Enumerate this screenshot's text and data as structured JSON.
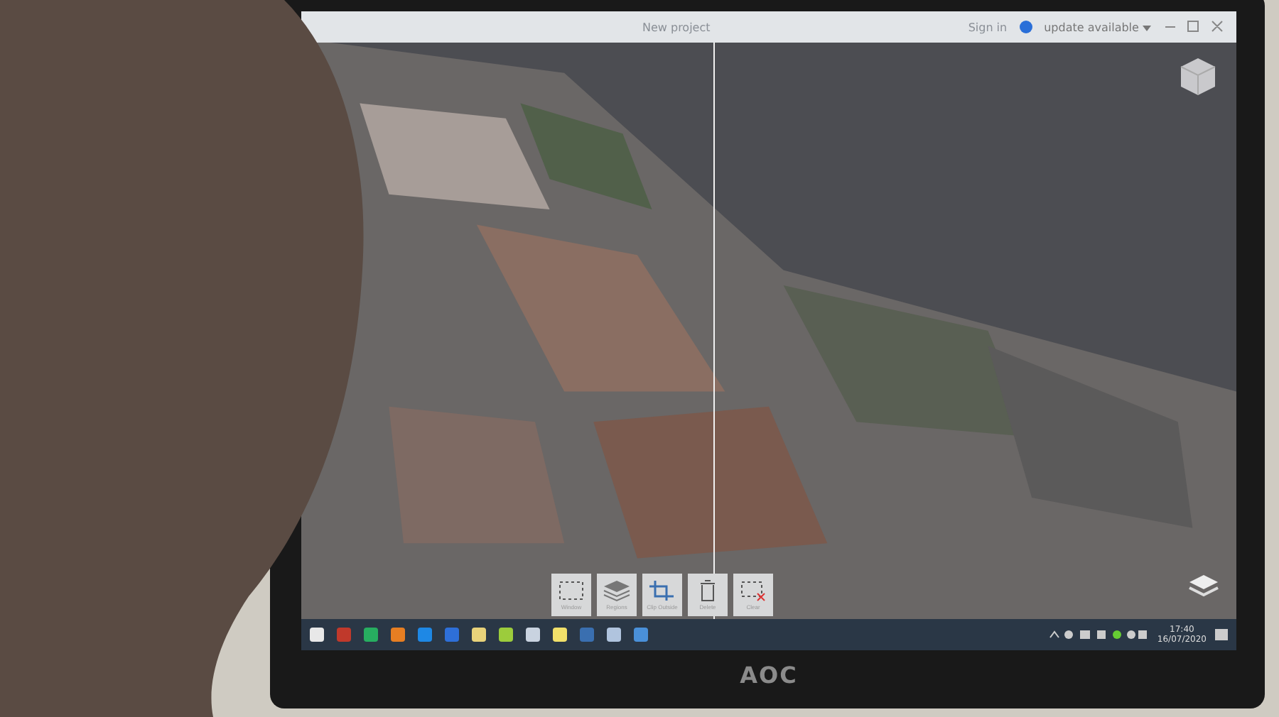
{
  "window": {
    "title": "New project"
  },
  "header": {
    "sign_in": "Sign in",
    "update": "update available"
  },
  "toolbar": [
    {
      "kind": "window",
      "label": "Window"
    },
    {
      "kind": "regions",
      "label": "Regions"
    },
    {
      "kind": "clip",
      "label": "Clip Outside"
    },
    {
      "kind": "delete",
      "label": "Delete"
    },
    {
      "kind": "clear",
      "label": "Clear"
    }
  ],
  "tray": {
    "time": "17:40",
    "date": "16/07/2020"
  },
  "monitor": {
    "brand": "AOC"
  }
}
